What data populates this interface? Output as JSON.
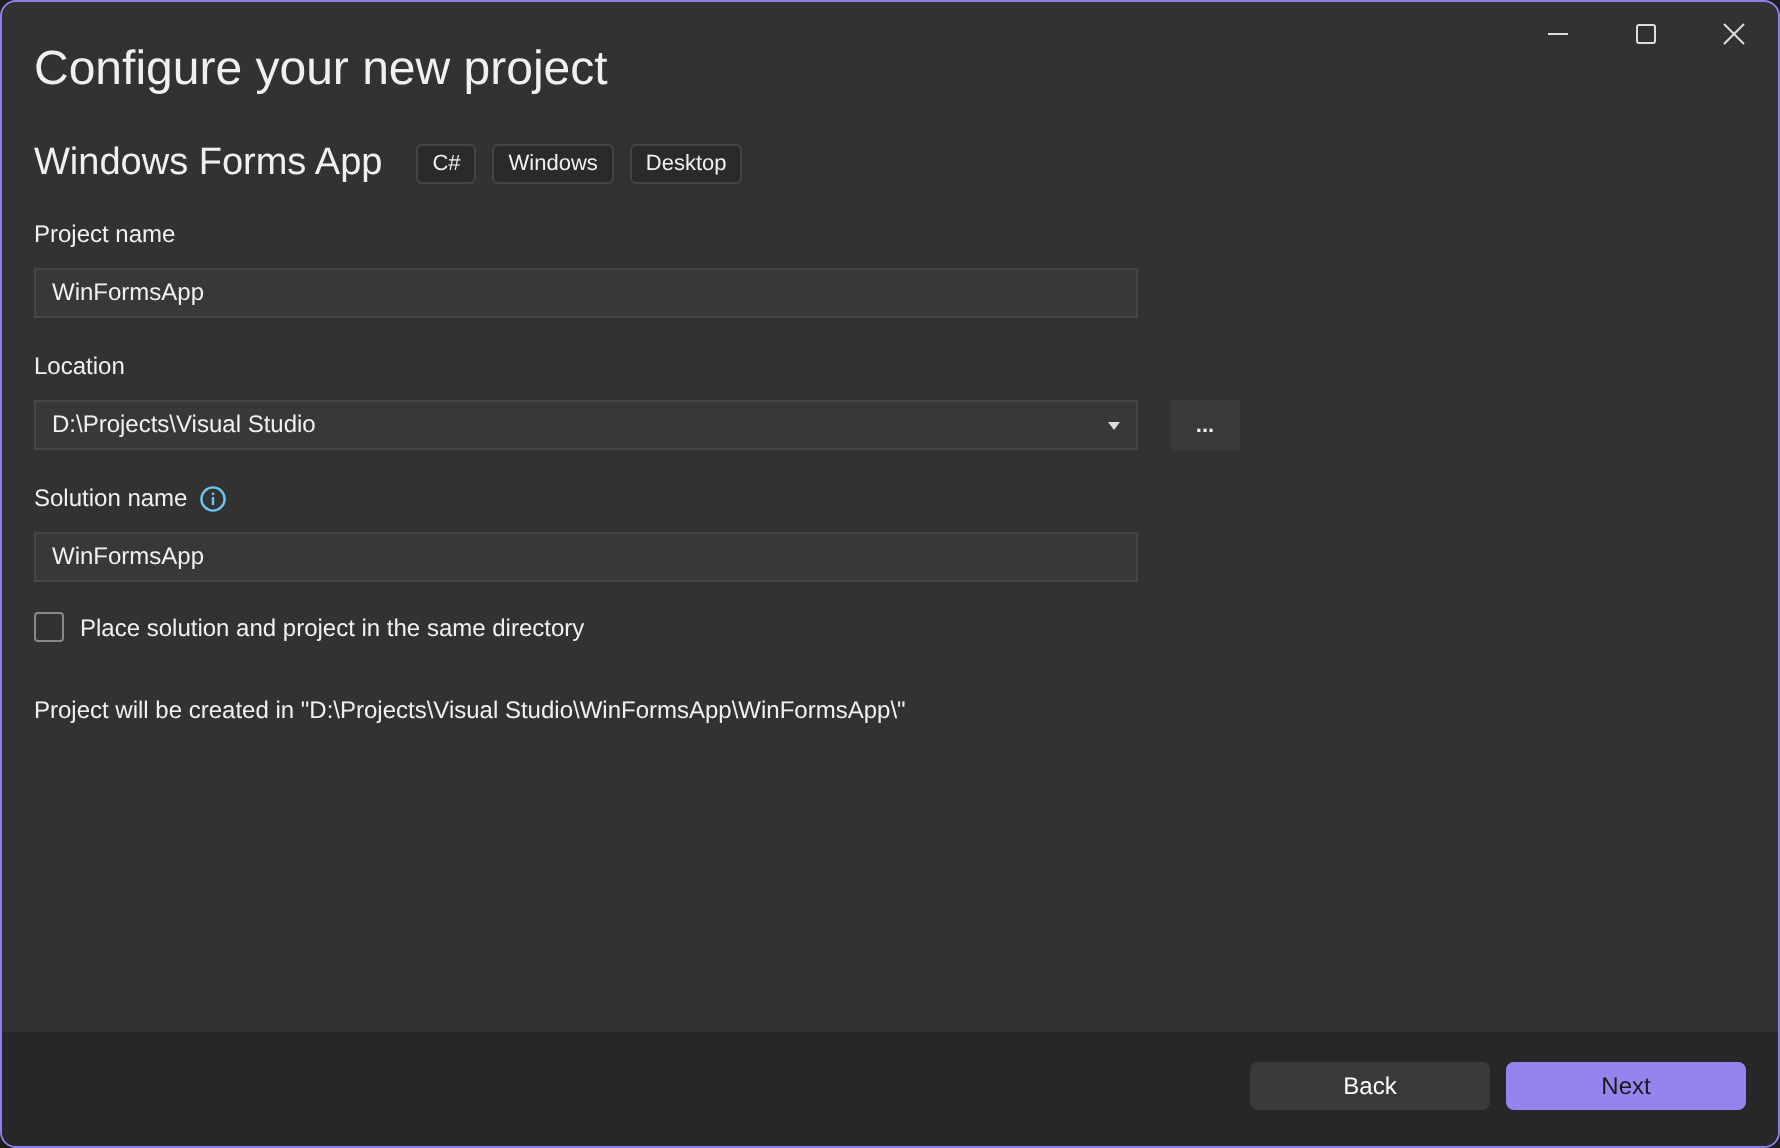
{
  "window": {
    "title": "Configure your new project"
  },
  "project": {
    "name": "Windows Forms App",
    "tags": [
      "C#",
      "Windows",
      "Desktop"
    ]
  },
  "fields": [
    {
      "kind": "text",
      "label": "Project name",
      "value": "WinFormsApp",
      "info": false
    },
    {
      "kind": "dropdown",
      "label": "Location",
      "value": "D:\\Projects\\Visual Studio",
      "browse": "...",
      "info": false
    },
    {
      "kind": "text",
      "label": "Solution name",
      "value": "WinFormsApp",
      "info": true
    }
  ],
  "checkbox": {
    "label": "Place solution and project in the same directory",
    "checked": false
  },
  "summary": "Project will be created in \"D:\\Projects\\Visual Studio\\WinFormsApp\\WinFormsApp\\\"",
  "buttons": [
    {
      "label": "Back",
      "primary": false
    },
    {
      "label": "Next",
      "primary": true
    }
  ]
}
